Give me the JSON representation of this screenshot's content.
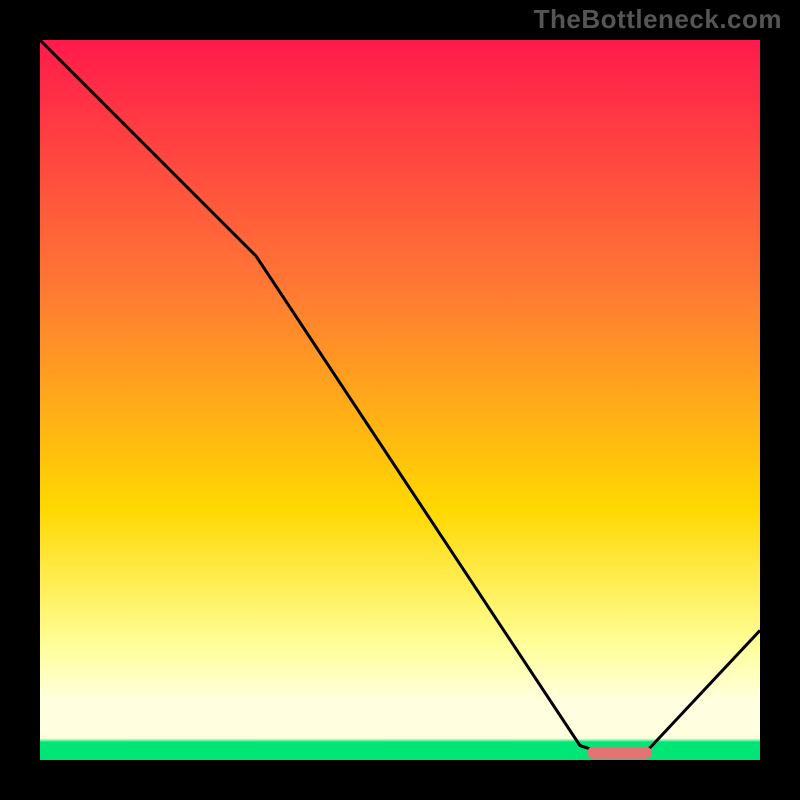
{
  "watermark": "TheBottleneck.com",
  "colors": {
    "frame": "#000000",
    "grad_top": "#ff1a4b",
    "grad_mid_high": "#ff7a33",
    "grad_mid": "#ffd800",
    "grad_low": "#ffff99",
    "grad_pale": "#ffffe0",
    "grad_green": "#00e676",
    "curve": "#000000",
    "marker": "#e57373"
  },
  "chart_data": {
    "type": "line",
    "title": "",
    "xlabel": "",
    "ylabel": "",
    "xlim": [
      0,
      100
    ],
    "ylim": [
      0,
      100
    ],
    "series": [
      {
        "name": "bottleneck-curve",
        "x": [
          0,
          27,
          30,
          75,
          78,
          84,
          85,
          100
        ],
        "values": [
          100,
          73,
          70,
          2,
          1,
          1,
          2,
          18
        ]
      }
    ],
    "optimum_marker": {
      "name": "optimum-band",
      "x_start": 76,
      "x_end": 85,
      "y": 1
    }
  }
}
